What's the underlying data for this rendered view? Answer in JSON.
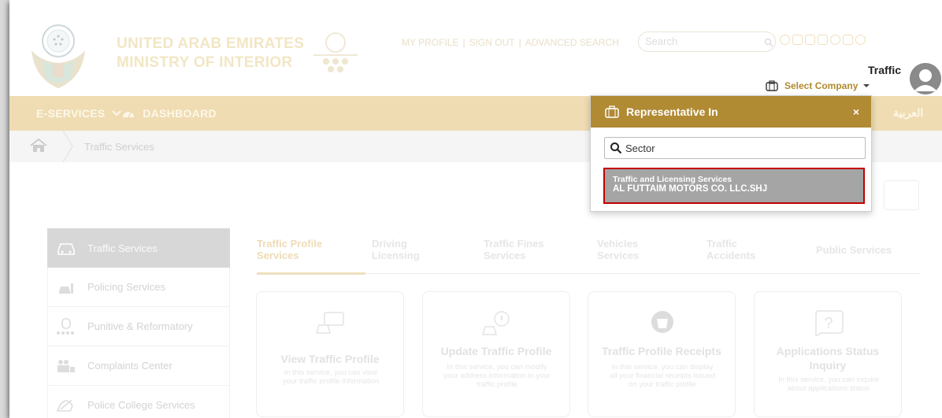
{
  "header": {
    "title_line1": "UNITED ARAB EMIRATES",
    "title_line2": "MINISTRY OF INTERIOR",
    "links": [
      "MY PROFILE",
      "SIGN OUT",
      "ADVANCED SEARCH"
    ],
    "link_separator": "|",
    "search_placeholder": "Search",
    "user_name": "Traffic",
    "select_company": "Select Company"
  },
  "nav": {
    "eservices": "E-SERVICES",
    "dashboard": "DASHBOARD",
    "language": "العربية"
  },
  "breadcrumb": {
    "current": "Traffic Services"
  },
  "sidebar": {
    "items": [
      {
        "label": "Traffic Services",
        "icon": "car-icon"
      },
      {
        "label": "Policing Services",
        "icon": "police-car-icon"
      },
      {
        "label": "Punitive & Reformatory",
        "icon": "handcuff-icon"
      },
      {
        "label": "Complaints Center",
        "icon": "people-icon"
      },
      {
        "label": "Police College Services",
        "icon": "college-icon"
      }
    ]
  },
  "tabs": [
    {
      "line1": "Traffic Profile",
      "line2": "Services"
    },
    {
      "line1": "Driving",
      "line2": "Licensing"
    },
    {
      "line1": "Traffic Fines",
      "line2": "Services"
    },
    {
      "line1": "Vehicles",
      "line2": "Services"
    },
    {
      "line1": "Traffic",
      "line2": "Accidents"
    },
    {
      "line1": "Public Services",
      "line2": ""
    }
  ],
  "cards": [
    {
      "title": "View Traffic Profile",
      "title2": "",
      "desc1": "In this service, you can view",
      "desc2": "your traffic profile information",
      "desc3": ""
    },
    {
      "title": "Update Traffic Profile",
      "title2": "",
      "desc1": "In this service, you can modify",
      "desc2": "your address information in your",
      "desc3": "traffic profile"
    },
    {
      "title": "Traffic Profile Receipts",
      "title2": "",
      "desc1": "In this service, you can display",
      "desc2": "all your financial receipts issued",
      "desc3": "on your traffic profile"
    },
    {
      "title": "Applications Status",
      "title2": "Inquiry",
      "desc1": "In this service, you can inquire",
      "desc2": "about applications status",
      "desc3": ""
    }
  ],
  "popup": {
    "title": "Representative In",
    "close": "×",
    "search_value": "Sector",
    "option_line1": "Traffic and Licensing Services",
    "option_line2": "AL FUTTAIM MOTORS CO. LLC.SHJ"
  },
  "colors": {
    "gold": "#b18a34",
    "highlight_border": "#c00000",
    "option_bg": "#a5a5a5"
  }
}
